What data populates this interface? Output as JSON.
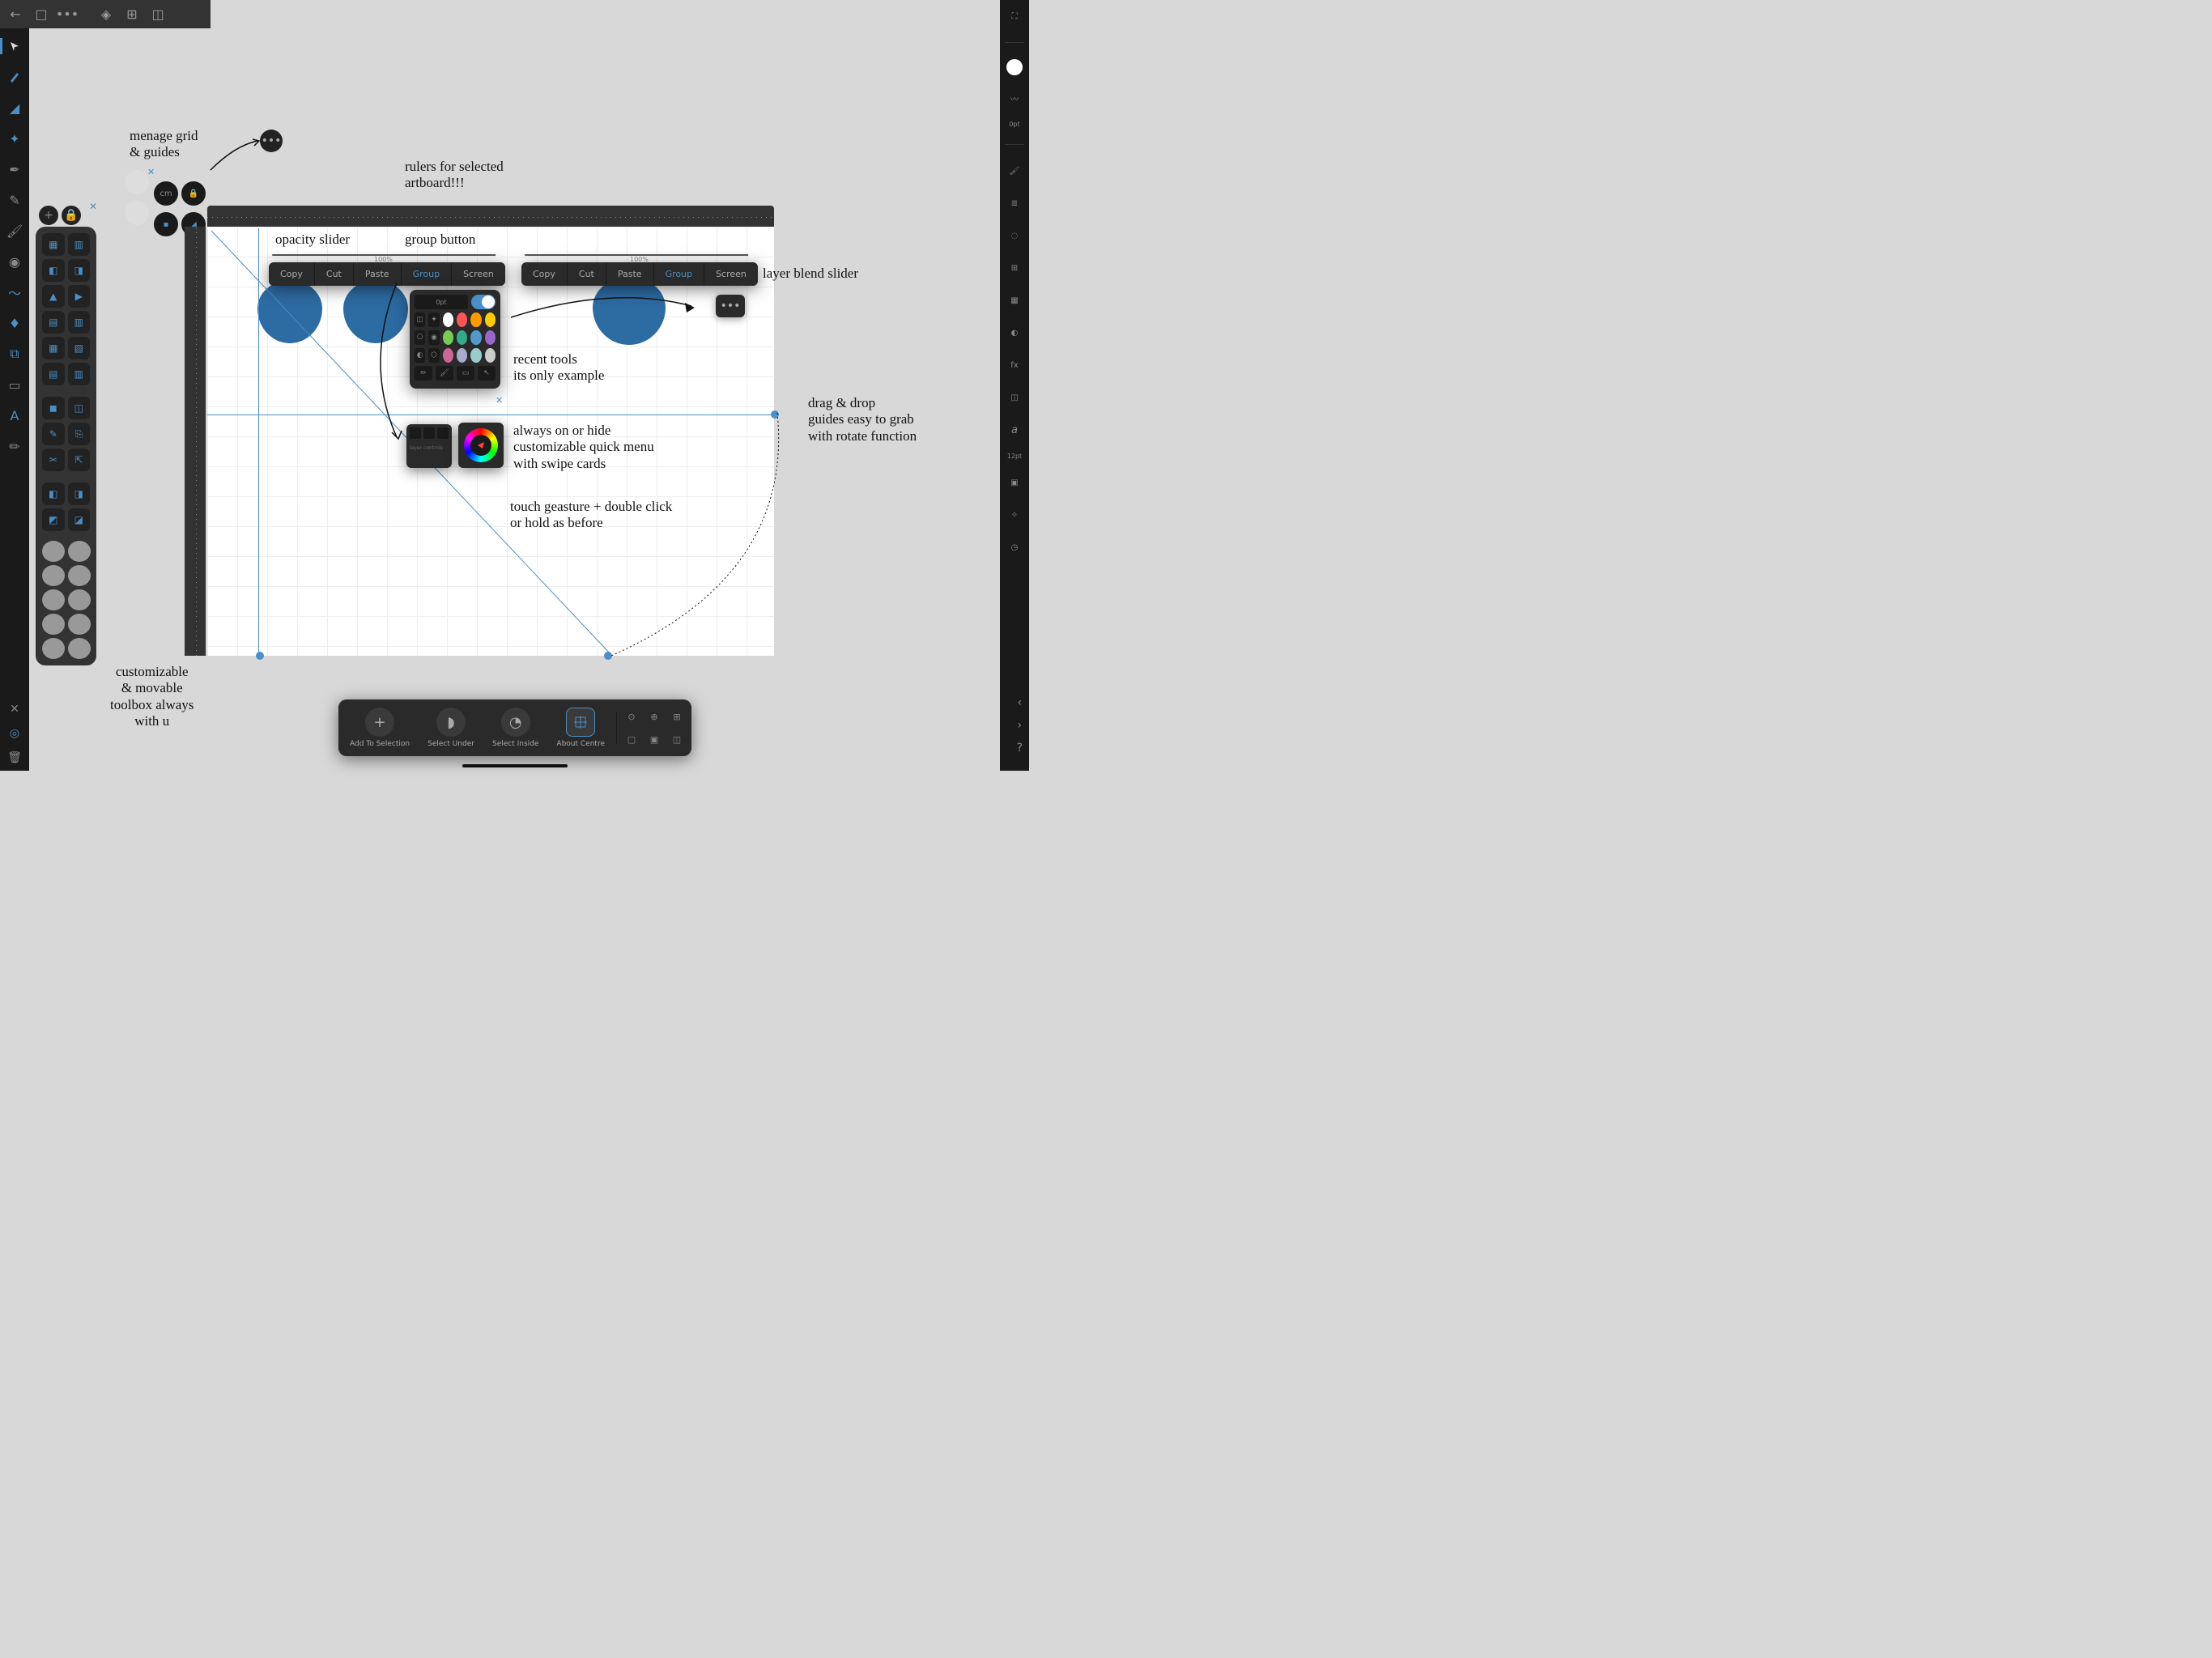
{
  "topbar": {
    "back": "←",
    "doc": "□",
    "more": "•••",
    "logo": "◈",
    "grid": "⊞",
    "dash": "◫"
  },
  "left_tools": [
    "move",
    "node",
    "corner",
    "pen",
    "pencil",
    "brush",
    "paint",
    "fill",
    "dropper",
    "vector-brush",
    "text",
    "crop",
    "rect",
    "frame",
    "mic"
  ],
  "left_active": 0,
  "right": {
    "stroke_weight": "0pt",
    "font_size": "12pt",
    "glyph": "a"
  },
  "annotations": {
    "grid": "menage grid\n& guides",
    "rulers": "rulers for selected\nartboard!!!",
    "opacity": "opacity slider",
    "group": "group button",
    "blend": "layer blend slider",
    "recent": "recent tools\nits only example",
    "quick": "always on or hide\ncustomizable quick menu\nwith swipe cards",
    "gesture": "touch geasture + double click\nor hold as before",
    "guides": "drag & drop\nguides easy to grab\nwith rotate function",
    "toolbox": "customizable\n& movable\ntoolbox always\nwith u"
  },
  "context_menu_items": [
    "Copy",
    "Cut",
    "Paste",
    "Group",
    "Screen"
  ],
  "slider_value": "100%",
  "stroke_opt": "0pt",
  "swatches": [
    [
      "#fff",
      "#f55",
      "#f90",
      "#fc0"
    ],
    [
      "#7c5",
      "#3a8",
      "#59c",
      "#96c"
    ],
    [
      "#c69",
      "#aac",
      "#9cc",
      "#ccc"
    ]
  ],
  "bottom_toolbar": {
    "add": "Add To Selection",
    "under": "Select Under",
    "inside": "Select Inside",
    "about": "About Centre"
  },
  "grid_controls": {
    "cm": "cm"
  }
}
